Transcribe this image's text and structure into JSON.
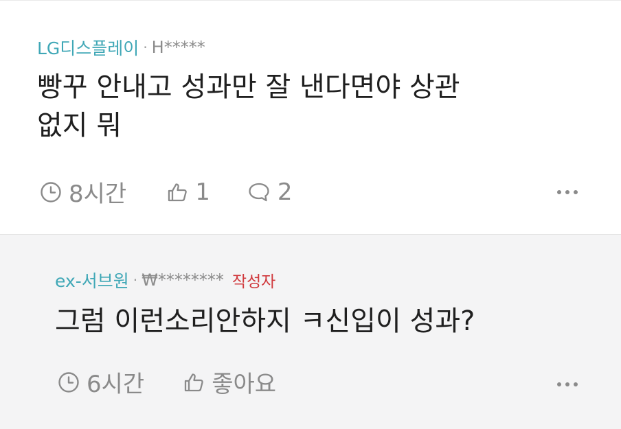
{
  "comments": [
    {
      "company": "LG디스플레이",
      "separator": "·",
      "author": "H*****",
      "text_lines": [
        "빵꾸 안내고 성과만 잘 낸다면야 상관",
        "없지 뭐"
      ],
      "time": "8시간",
      "likes": "1",
      "replies": "2",
      "icons": [
        "clock-icon",
        "thumbs-up-icon",
        "speech-bubble-icon",
        "more-icon"
      ]
    },
    {
      "company": "ex-서브원",
      "separator": "·",
      "author": "₩********",
      "writer_badge": "작성자",
      "text_lines": [
        "그럼 이런소리안하지 ㅋ신입이 성과?"
      ],
      "time": "6시간",
      "like_label": "좋아요",
      "icons": [
        "clock-icon",
        "thumbs-up-icon",
        "more-icon"
      ]
    }
  ],
  "colors": {
    "company": "#3fa7b6",
    "writer_badge": "#d0393d",
    "text": "#1f1f1f",
    "meta": "#8a8a8a",
    "reply_bg": "#f4f4f5"
  }
}
